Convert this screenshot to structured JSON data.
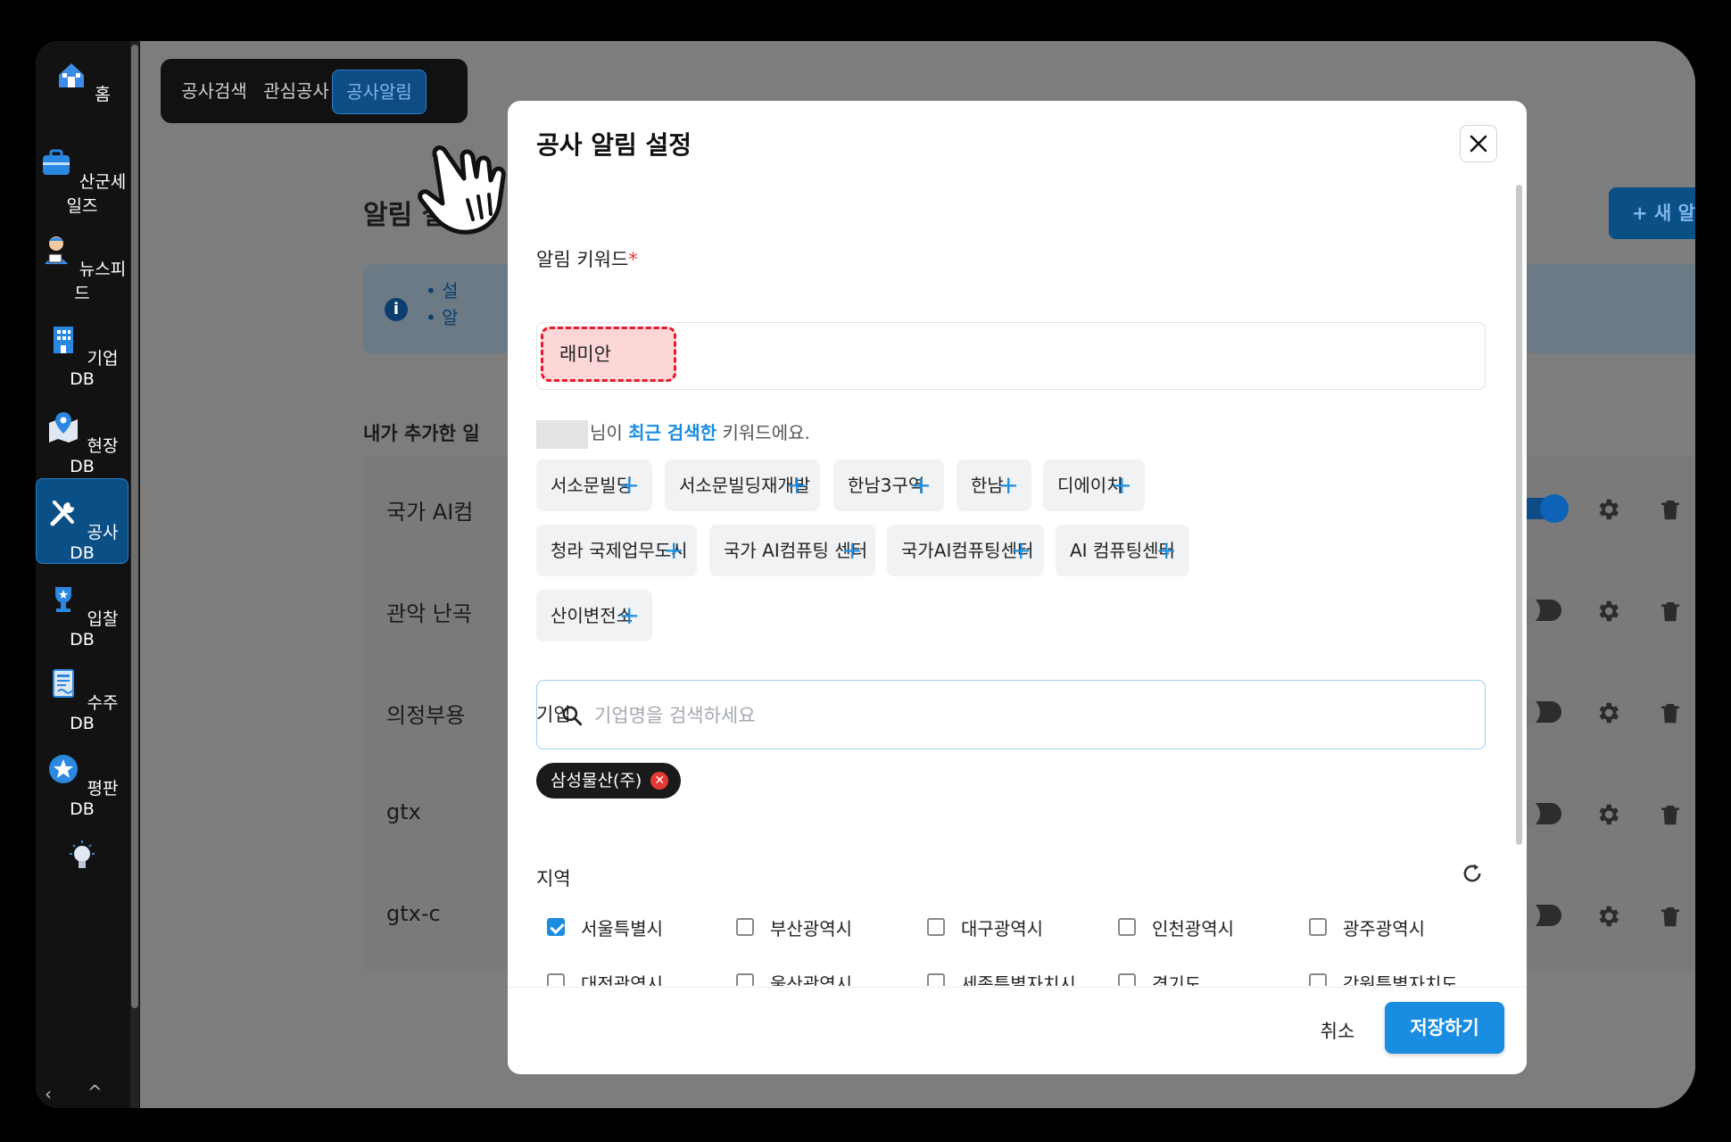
{
  "sidebar": {
    "items": [
      {
        "label": "홈",
        "icon": "home-icon"
      },
      {
        "label": "산군세일즈",
        "icon": "briefcase-icon"
      },
      {
        "label": "뉴스피드",
        "icon": "news-reporter-icon"
      },
      {
        "label": "기업DB",
        "icon": "building-icon"
      },
      {
        "label": "현장DB",
        "icon": "map-pin-icon"
      },
      {
        "label": "공사DB",
        "icon": "tools-icon"
      },
      {
        "label": "입찰DB",
        "icon": "trophy-icon"
      },
      {
        "label": "수주DB",
        "icon": "contract-icon"
      },
      {
        "label": "평판DB",
        "icon": "star-badge-icon"
      },
      {
        "label": "",
        "icon": "lightbulb-icon"
      }
    ],
    "active_label": "공사DB"
  },
  "tabs": [
    "공사검색",
    "관심공사",
    "공사알림"
  ],
  "page": {
    "title": "알림 설정",
    "info_lines": [
      "설",
      "알"
    ],
    "new_button": "+ 새 알림",
    "list_title": "내가 추가한 일",
    "rows": [
      {
        "name": "국가 AI컴",
        "enabled": true
      },
      {
        "name": "관악 난곡",
        "enabled": false
      },
      {
        "name": "의정부용",
        "enabled": false
      },
      {
        "name": "gtx",
        "enabled": false
      },
      {
        "name": "gtx-c",
        "enabled": false
      }
    ]
  },
  "modal": {
    "title": "공사 알림 설정",
    "keyword_label": "알림 키워드",
    "keyword_required_mark": "*",
    "keyword_value": "래미안",
    "hint_prefix": "님이",
    "hint_highlight": "최근 검색한",
    "hint_suffix": "키워드에요.",
    "recent_keywords": [
      "서소문빌딩",
      "서소문빌딩재개발",
      "한남3구역",
      "한남",
      "디에이치",
      "청라 국제업무도시",
      "국가 AI컴퓨팅 센터",
      "국가AI컴퓨팅센터",
      "AI 컴퓨팅센터",
      "산이변전소"
    ],
    "company_label": "기업",
    "company_placeholder": "기업명을 검색하세요",
    "selected_company": "삼성물산(주)",
    "region_label": "지역",
    "regions": [
      {
        "name": "서울특별시",
        "checked": true
      },
      {
        "name": "부산광역시",
        "checked": false
      },
      {
        "name": "대구광역시",
        "checked": false
      },
      {
        "name": "인천광역시",
        "checked": false
      },
      {
        "name": "광주광역시",
        "checked": false
      },
      {
        "name": "대전광역시",
        "checked": false
      },
      {
        "name": "울산광역시",
        "checked": false
      },
      {
        "name": "세종특별자치시",
        "checked": false
      },
      {
        "name": "경기도",
        "checked": false
      },
      {
        "name": "강원특별자치도",
        "checked": false
      }
    ],
    "cancel_label": "취소",
    "save_label": "저장하기"
  },
  "colors": {
    "accent": "#1a8de0",
    "sidebar_active": "#0b4f87",
    "required": "#e53935",
    "keyword_highlight": "#e8192c"
  }
}
